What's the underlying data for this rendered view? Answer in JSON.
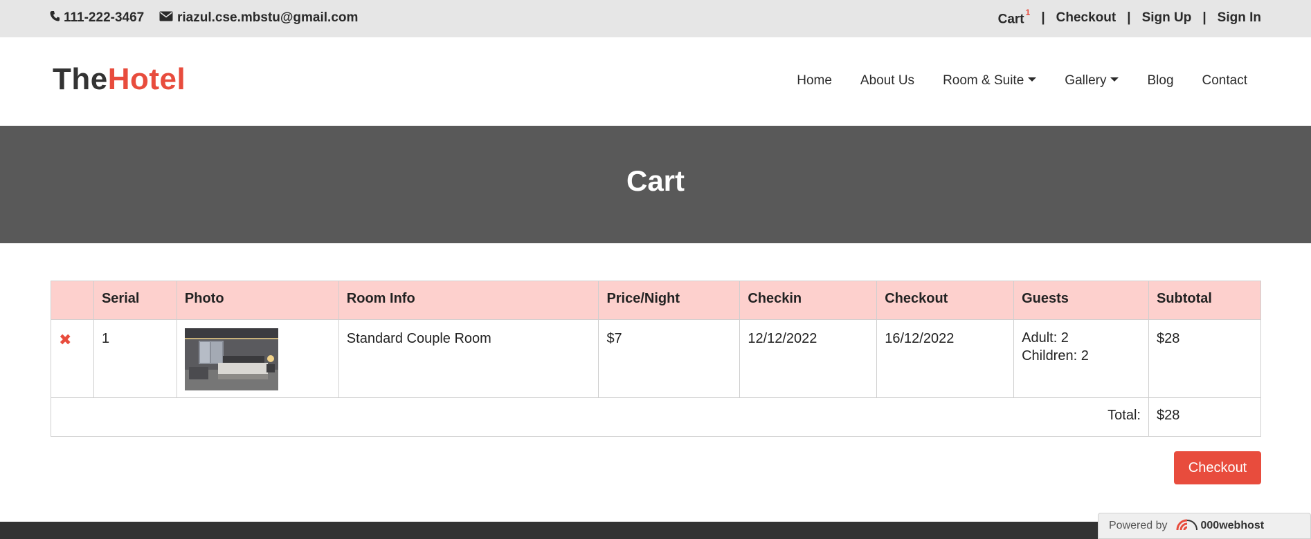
{
  "topbar": {
    "phone": "111-222-3467",
    "email": "riazul.cse.mbstu@gmail.com",
    "links": {
      "cart": "Cart",
      "cart_count": "1",
      "checkout": "Checkout",
      "signup": "Sign Up",
      "signin": "Sign In"
    },
    "separator": "|"
  },
  "brand": {
    "part1": "The",
    "part2": "Hotel"
  },
  "nav": {
    "home": "Home",
    "about": "About Us",
    "rooms": "Room & Suite",
    "gallery": "Gallery",
    "blog": "Blog",
    "contact": "Contact"
  },
  "banner": {
    "title": "Cart"
  },
  "table": {
    "headers": [
      "",
      "Serial",
      "Photo",
      "Room Info",
      "Price/Night",
      "Checkin",
      "Checkout",
      "Guests",
      "Subtotal"
    ],
    "rows": [
      {
        "serial": "1",
        "room_info": "Standard Couple Room",
        "price": "$7",
        "checkin": "12/12/2022",
        "checkout": "16/12/2022",
        "adults": "Adult: 2",
        "children": "Children: 2",
        "subtotal": "$28"
      }
    ],
    "total_label": "Total:",
    "total_value": "$28"
  },
  "checkout_button": "Checkout",
  "powered": {
    "label": "Powered by",
    "host": "000webhost"
  },
  "colors": {
    "accent": "#e84c3d",
    "header_bg": "#fdd0cd",
    "banner_bg": "#595959",
    "topbar_bg": "#e6e6e6"
  },
  "icons": {
    "phone": "phone-icon",
    "email": "envelope-icon",
    "remove": "remove-x-icon"
  }
}
